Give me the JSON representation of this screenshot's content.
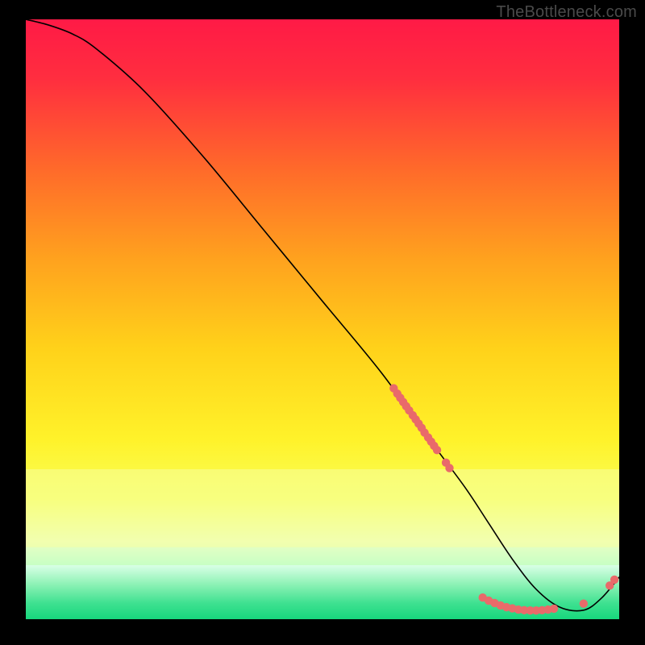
{
  "watermark": "TheBottleneck.com",
  "chart_data": {
    "type": "line",
    "title": "",
    "xlabel": "",
    "ylabel": "",
    "xlim": [
      0,
      100
    ],
    "ylim": [
      0,
      100
    ],
    "series": [
      {
        "name": "curve",
        "x": [
          0,
          4,
          8,
          12,
          20,
          30,
          40,
          50,
          60,
          68,
          74,
          78,
          82,
          86,
          90,
          94,
          97,
          100
        ],
        "y": [
          100,
          99,
          97.5,
          95,
          88,
          77,
          65,
          53,
          41,
          30,
          22,
          16,
          10,
          5,
          2,
          1.5,
          3.5,
          7
        ]
      }
    ],
    "scatter_clusters": [
      {
        "name": "upper-cluster",
        "color": "#e96a6a",
        "points": [
          [
            62,
            38.5
          ],
          [
            62.6,
            37.6
          ],
          [
            63.1,
            36.9
          ],
          [
            63.6,
            36.2
          ],
          [
            64.1,
            35.5
          ],
          [
            64.6,
            34.8
          ],
          [
            65.2,
            34.0
          ],
          [
            65.7,
            33.3
          ],
          [
            66.2,
            32.6
          ],
          [
            66.7,
            31.9
          ],
          [
            67.2,
            31.1
          ],
          [
            67.8,
            30.3
          ],
          [
            68.3,
            29.6
          ],
          [
            68.8,
            28.9
          ],
          [
            69.3,
            28.2
          ]
        ]
      },
      {
        "name": "dip-pair",
        "color": "#e96a6a",
        "points": [
          [
            70.8,
            26.1
          ],
          [
            71.4,
            25.2
          ]
        ]
      },
      {
        "name": "bottom-cluster",
        "color": "#e96a6a",
        "points": [
          [
            77.0,
            3.6
          ],
          [
            78.0,
            3.1
          ],
          [
            79.0,
            2.7
          ],
          [
            80.0,
            2.3
          ],
          [
            81.0,
            2.0
          ],
          [
            82.0,
            1.8
          ],
          [
            83.0,
            1.6
          ],
          [
            84.0,
            1.5
          ],
          [
            85.0,
            1.45
          ],
          [
            86.0,
            1.45
          ],
          [
            87.0,
            1.5
          ],
          [
            88.0,
            1.6
          ],
          [
            89.0,
            1.75
          ]
        ]
      },
      {
        "name": "rise-points",
        "color": "#e96a6a",
        "points": [
          [
            94.0,
            2.6
          ],
          [
            98.4,
            5.6
          ],
          [
            99.2,
            6.6
          ]
        ]
      }
    ],
    "background_gradient": {
      "stops": [
        {
          "offset": 0.0,
          "color": "#ff1a46"
        },
        {
          "offset": 0.1,
          "color": "#ff2e3f"
        },
        {
          "offset": 0.25,
          "color": "#ff6a2a"
        },
        {
          "offset": 0.4,
          "color": "#ffa21e"
        },
        {
          "offset": 0.55,
          "color": "#ffd21a"
        },
        {
          "offset": 0.7,
          "color": "#fff22a"
        },
        {
          "offset": 0.8,
          "color": "#f8ff58"
        },
        {
          "offset": 0.87,
          "color": "#eaffc3"
        },
        {
          "offset": 0.93,
          "color": "#b6ffc5"
        },
        {
          "offset": 0.965,
          "color": "#4ef19a"
        },
        {
          "offset": 1.0,
          "color": "#17d77d"
        }
      ]
    },
    "yellow_band": {
      "y_top": 25,
      "y_bottom": 12,
      "color": "#f8ff9e"
    },
    "green_band": {
      "y_top": 9,
      "y_bottom": 0,
      "stops": [
        {
          "offset": 0.0,
          "color": "#d9ffe6"
        },
        {
          "offset": 0.35,
          "color": "#8ef2b6"
        },
        {
          "offset": 0.7,
          "color": "#3fe191"
        },
        {
          "offset": 1.0,
          "color": "#17d77d"
        }
      ]
    }
  }
}
